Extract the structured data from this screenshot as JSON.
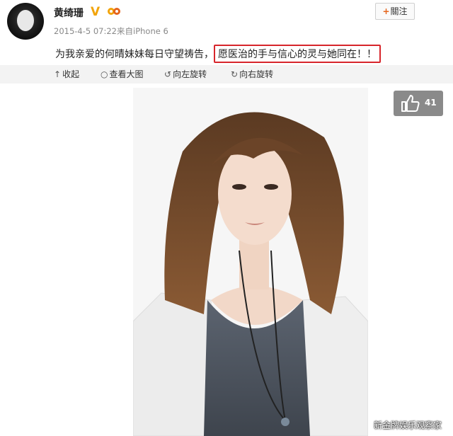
{
  "user": {
    "name": "黄绮珊",
    "verified_badge": "V",
    "meta": "2015-4-5 07:22来自iPhone 6",
    "follow_label": "關注",
    "follow_plus": "+"
  },
  "post": {
    "text_plain": "为我亲爱的何晴妹妹每日守望祷告，",
    "text_highlight": "愿医治的手与信心的灵与她同在！！",
    "highlight_color": "#d7252b"
  },
  "toolbar": {
    "collapse": "收起",
    "view_large": "查看大图",
    "rotate_left": "向左旋转",
    "rotate_right": "向右旋转"
  },
  "like": {
    "count": "41"
  },
  "watermark": "新金牌娱乐观察家",
  "colors": {
    "badge": "#f2a40a",
    "follow_plus": "#e5641b",
    "like_bg": "#8a8a8a"
  }
}
